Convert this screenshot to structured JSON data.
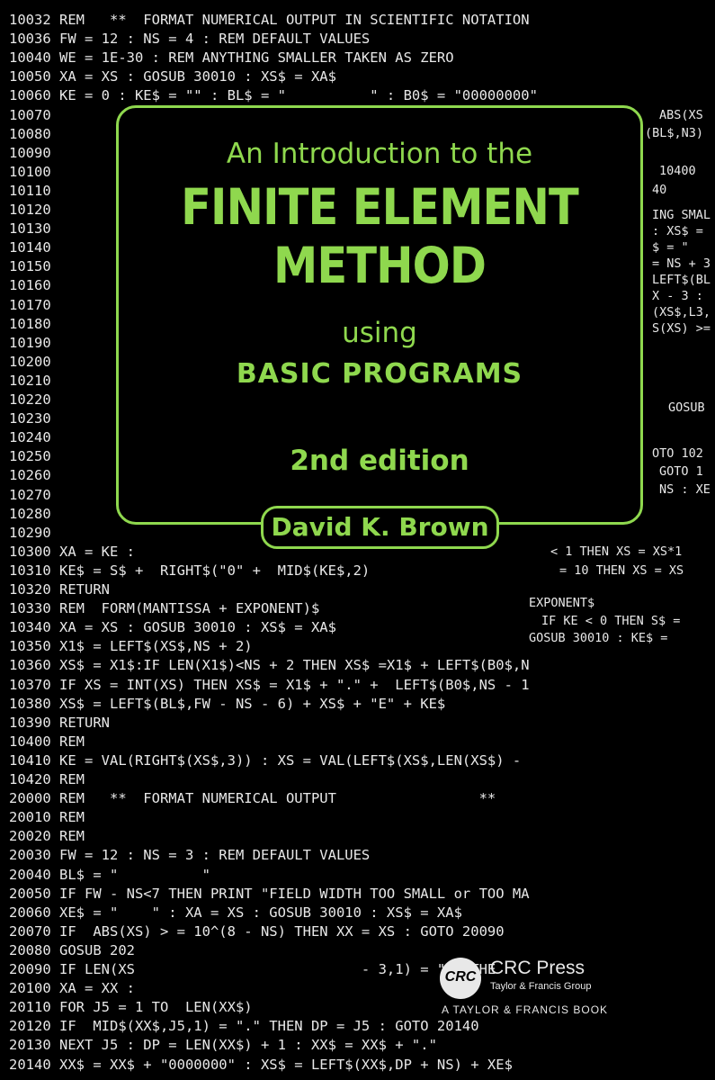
{
  "cover": {
    "intro": "An Introduction to the",
    "title_line1": "FINITE ELEMENT",
    "title_line2": "METHOD",
    "using": "using",
    "subtitle": "BASIC PROGRAMS",
    "edition": "2nd edition",
    "author": "David K. Brown"
  },
  "publisher": {
    "logo_mark": "CRC",
    "name": "CRC Press",
    "group": "Taylor & Francis Group",
    "tagline": "A TAYLOR & FRANCIS BOOK"
  },
  "code_lines": [
    "10032 REM   **  FORMAT NUMERICAL OUTPUT IN SCIENTIFIC NOTATION",
    "10036 FW = 12 : NS = 4 : REM DEFAULT VALUES",
    "10040 WE = 1E-30 : REM ANYTHING SMALLER TAKEN AS ZERO",
    "10050 XA = XS : GOSUB 30010 : XS$ = XA$",
    "10060 KE = 0 : KE$ = \"\" : BL$ = \"          \" : B0$ = \"00000000\"",
    "10070",
    "10080",
    "10090",
    "10100",
    "10110",
    "10120",
    "10130",
    "10140",
    "10150",
    "10160",
    "10170",
    "10180",
    "10190",
    "10200",
    "10210",
    "10220",
    "10230",
    "10240",
    "10250",
    "10260",
    "10270",
    "10280",
    "10290",
    "10300 XA = KE :",
    "10310 KE$ = S$ +  RIGHT$(\"0\" +  MID$(KE$,2)",
    "10320 RETURN",
    "10330 REM  FORM(MANTISSA + EXPONENT)$",
    "10340 XA = XS : GOSUB 30010 : XS$ = XA$",
    "10350 X1$ = LEFT$(XS$,NS + 2)",
    "10360 XS$ = X1$:IF LEN(X1$)<NS + 2 THEN XS$ =X1$ + LEFT$(B0$,N",
    "10370 IF XS = INT(XS) THEN XS$ = X1$ + \".\" +  LEFT$(B0$,NS - 1",
    "10380 XS$ = LEFT$(BL$,FW - NS - 6) + XS$ + \"E\" + KE$",
    "10390 RETURN",
    "10400 REM",
    "10410 KE = VAL(RIGHT$(XS$,3)) : XS = VAL(LEFT$(XS$,LEN(XS$) -",
    "10420 REM",
    "20000 REM   **  FORMAT NUMERICAL OUTPUT                 **",
    "20010 REM",
    "20020 REM",
    "20030 FW = 12 : NS = 3 : REM DEFAULT VALUES",
    "20040 BL$ = \"          \"",
    "20050 IF FW - NS<7 THEN PRINT \"FIELD WIDTH TOO SMALL or TOO MA",
    "20060 XE$ = \"    \" : XA = XS : GOSUB 30010 : XS$ = XA$",
    "20070 IF  ABS(XS) > = 10^(8 - NS) THEN XX = XS : GOTO 20090",
    "20080 GOSUB 202",
    "20090 IF LEN(XS                           - 3,1) = \"E\" THE",
    "20100 XA = XX :",
    "20110 FOR J5 = 1 TO  LEN(XX$)",
    "20120 IF  MID$(XX$,J5,1) = \".\" THEN DP = J5 : GOTO 20140",
    "20130 NEXT J5 : DP = LEN(XX$) + 1 : XX$ = XX$ + \".\"",
    "20140 XX$ = XX$ + \"0000000\" : XS$ = LEFT$(XX$,DP + NS) + XE$"
  ],
  "right_fragments": [
    "ABS(XS",
    "(BL$,N3)",
    "10400",
    "40",
    "ING SMAL",
    ": XS$ =",
    "$ = \"",
    "= NS + 3",
    "LEFT$(BL",
    "X - 3 :",
    "(XS$,L3,",
    "S(XS) >=",
    "GOSUB",
    "OTO 102",
    "GOTO 1",
    "NS : XE",
    "< 1 THEN XS = XS*1",
    "= 10 THEN XS = XS",
    "EXPONENT$",
    "IF KE < 0 THEN S$ =",
    "GOSUB 30010 : KE$ ="
  ]
}
